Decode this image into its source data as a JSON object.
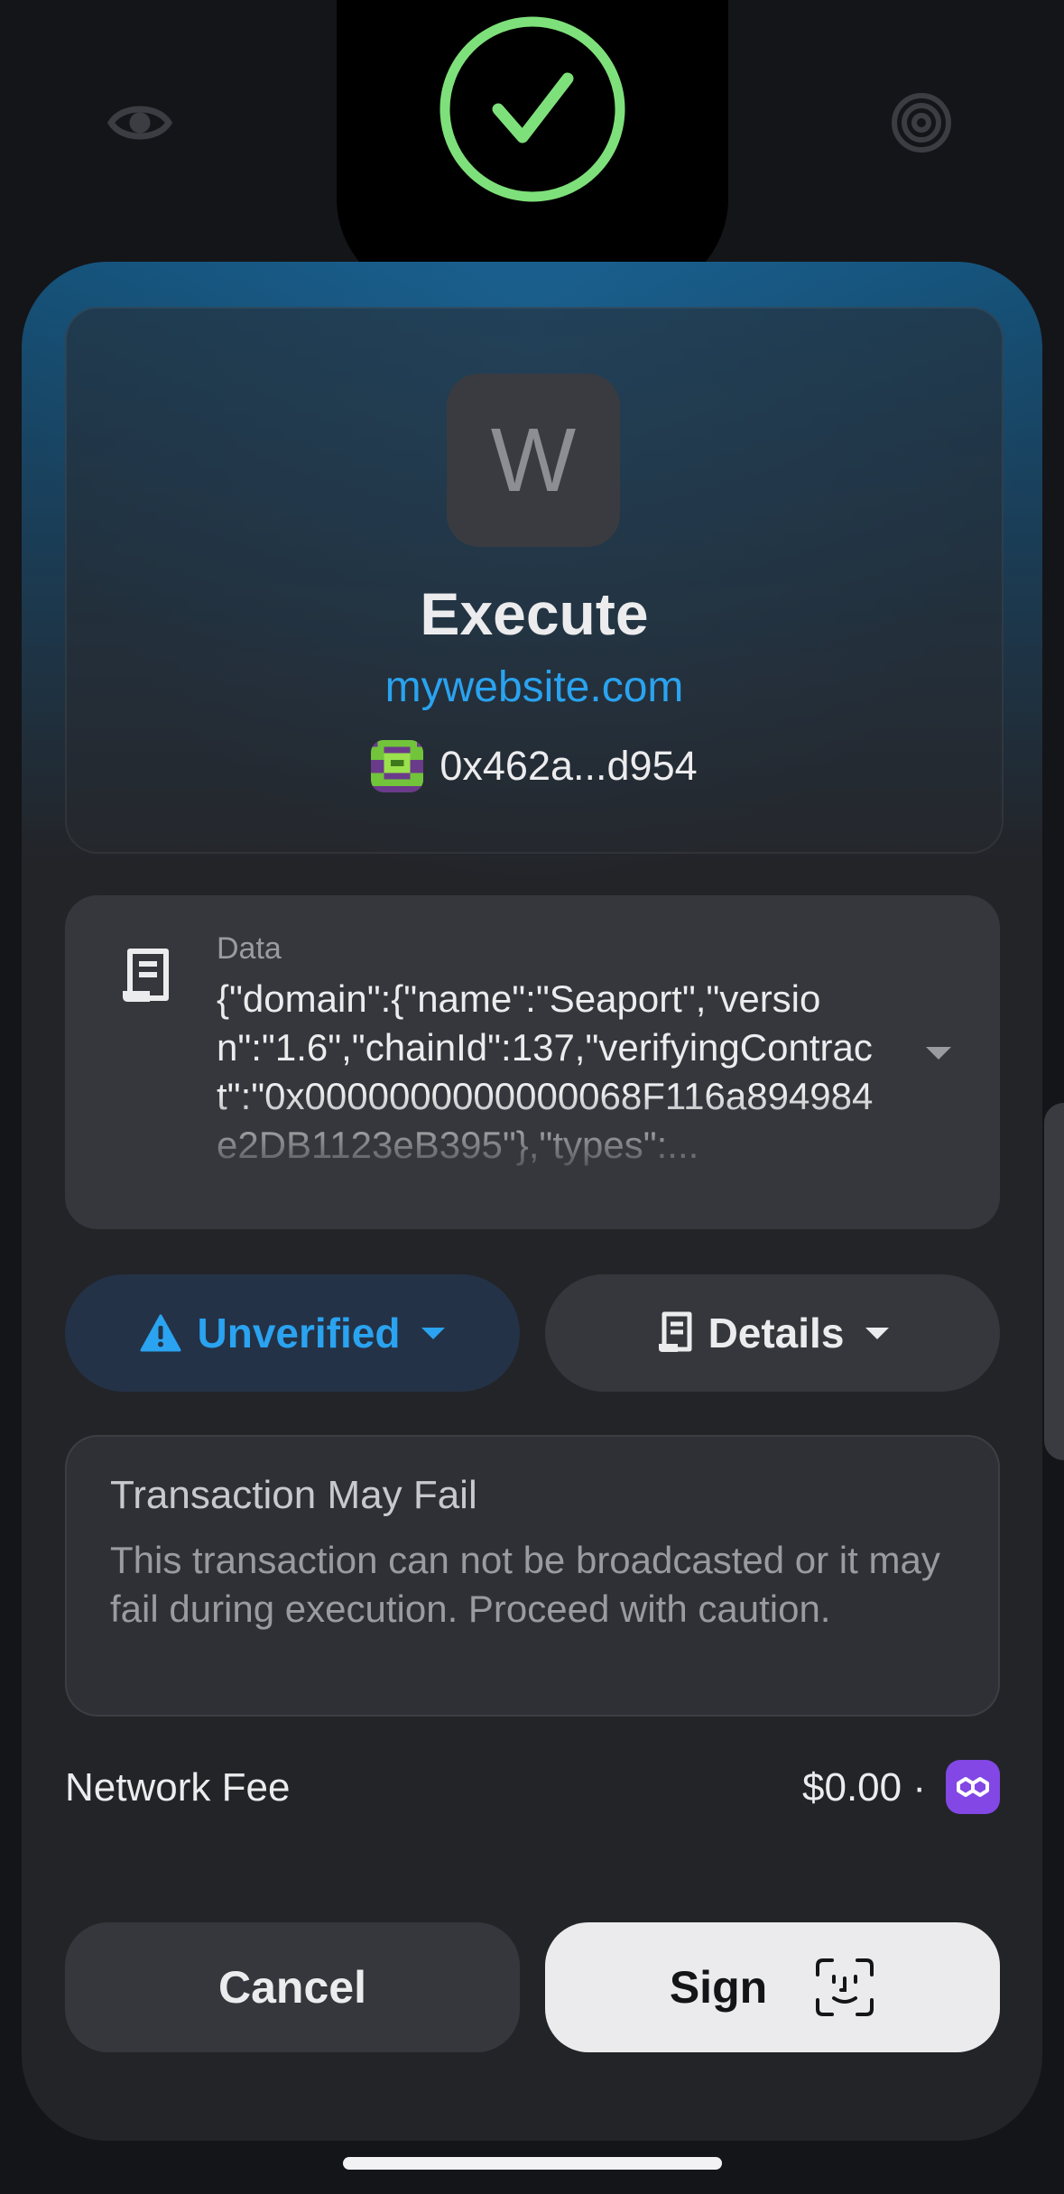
{
  "header": {
    "left_icon": "eye-icon",
    "right_icon": "target-icon",
    "island_status_icon": "check-circle-icon",
    "success_color": "#7ee07a"
  },
  "site": {
    "app_initial": "W",
    "action_title": "Execute",
    "domain": "mywebsite.com",
    "account_address": "0x462a...d954",
    "link_color": "#2aa3f0"
  },
  "data_section": {
    "label": "Data",
    "value": "{\"domain\":{\"name\":\"Seaport\",\"version\":\"1.6\",\"chainId\":137,\"verifyingContract\":\"0x0000000000000068F116a894984e2DB1123eB395\"},\"types\":..."
  },
  "pills": {
    "unverified_label": "Unverified",
    "details_label": "Details"
  },
  "warning": {
    "title": "Transaction May Fail",
    "message": "This transaction can not be broadcasted or it may fail during execution. Proceed with caution."
  },
  "fee": {
    "label": "Network Fee",
    "value": "$0.00 ·",
    "chain_icon": "polygon-icon",
    "chain_color": "#8247e5"
  },
  "actions": {
    "cancel_label": "Cancel",
    "sign_label": "Sign",
    "sign_icon": "face-id-icon"
  }
}
